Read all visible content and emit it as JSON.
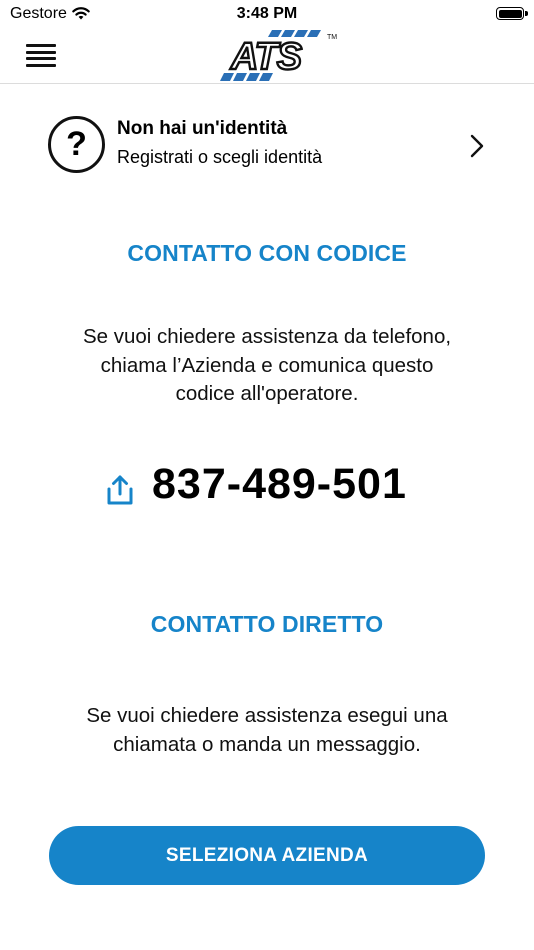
{
  "status_bar": {
    "carrier": "Gestore",
    "time": "3:48 PM"
  },
  "nav": {
    "menu_icon": "hamburger-menu-icon",
    "logo_text": "ATS",
    "logo_trademark": "TM"
  },
  "identity": {
    "icon": "question-circle-icon",
    "title": "Non hai un'identità",
    "subtitle": "Registrati o scegli identità"
  },
  "code_contact": {
    "title": "CONTATTO CON CODICE",
    "description_lines": [
      "Se vuoi chiedere assistenza da telefono,",
      "chiama l’Azienda e comunica questo",
      "codice all'operatore."
    ],
    "share_icon": "share-icon",
    "code": "837-489-501"
  },
  "direct_contact": {
    "title": "CONTATTO DIRETTO",
    "description_lines": [
      "Se vuoi chiedere assistenza esegui una",
      "chiamata o manda un messaggio."
    ]
  },
  "select_button": {
    "label": "SELEZIONA AZIENDA"
  },
  "colors": {
    "accent": "#1684c9",
    "logo_blue": "#2a6fb6",
    "text": "#111111"
  }
}
